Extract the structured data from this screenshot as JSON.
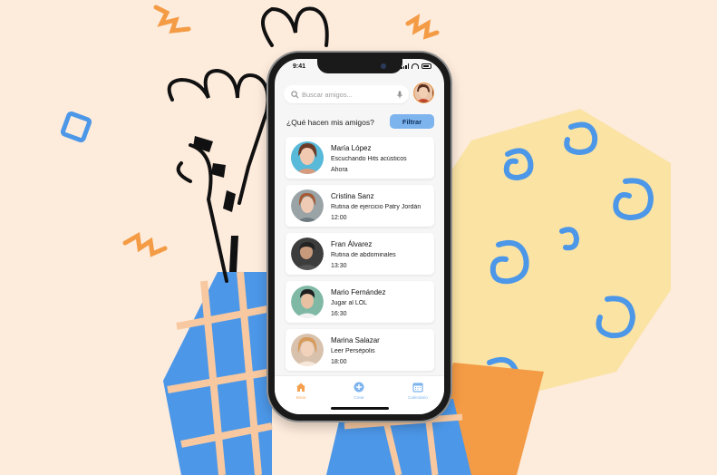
{
  "status": {
    "time": "9:41"
  },
  "search": {
    "placeholder": "Buscar amigos..."
  },
  "header": {
    "title": "¿Qué hacen mis amigos?",
    "filter_label": "Filtrar"
  },
  "friends": [
    {
      "name": "María López",
      "activity": "Escuchando Hits acústicos",
      "time": "Ahora"
    },
    {
      "name": "Cristina Sanz",
      "activity": "Rutina de ejercicio Patry Jordán",
      "time": "12:00"
    },
    {
      "name": "Fran Álvarez",
      "activity": "Rutina de abdominales",
      "time": "13:30"
    },
    {
      "name": "Mario Fernández",
      "activity": "Jugar al LOL",
      "time": "16:30"
    },
    {
      "name": "Marina Salazar",
      "activity": "Leer Persépolis",
      "time": "18:00"
    }
  ],
  "tabs": [
    {
      "label": "Inicio",
      "icon": "home-icon",
      "color": "#f5a04d"
    },
    {
      "label": "Crear",
      "icon": "plus-circle-icon",
      "color": "#7eb4ee"
    },
    {
      "label": "Calendario",
      "icon": "calendar-icon",
      "color": "#7eb4ee"
    }
  ],
  "colors": {
    "background": "#fdebdc",
    "accent_blue": "#7eb4ee",
    "accent_orange": "#f5a04d"
  }
}
